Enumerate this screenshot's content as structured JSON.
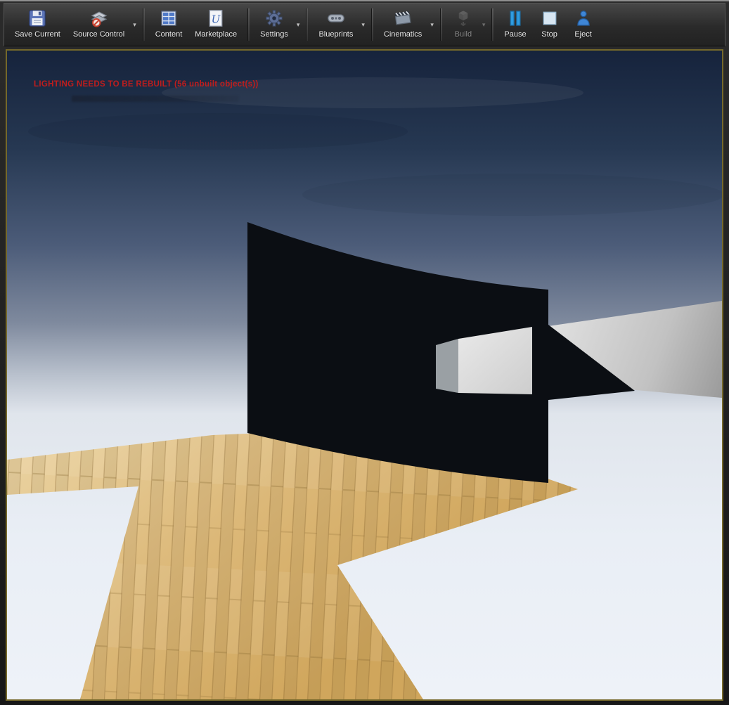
{
  "toolbar": {
    "groups": [
      [
        {
          "label": "Save Current",
          "icon": "save-icon",
          "dropdown": false,
          "enabled": true
        },
        {
          "label": "Source Control",
          "icon": "source-control-icon",
          "dropdown": true,
          "enabled": true
        }
      ],
      [
        {
          "label": "Content",
          "icon": "content-icon",
          "dropdown": false,
          "enabled": true
        },
        {
          "label": "Marketplace",
          "icon": "marketplace-icon",
          "dropdown": false,
          "enabled": true
        }
      ],
      [
        {
          "label": "Settings",
          "icon": "settings-icon",
          "dropdown": true,
          "enabled": true
        }
      ],
      [
        {
          "label": "Blueprints",
          "icon": "blueprints-icon",
          "dropdown": true,
          "enabled": true
        }
      ],
      [
        {
          "label": "Cinematics",
          "icon": "cinematics-icon",
          "dropdown": true,
          "enabled": true
        }
      ],
      [
        {
          "label": "Build",
          "icon": "build-icon",
          "dropdown": true,
          "enabled": false
        }
      ],
      [
        {
          "label": "Pause",
          "icon": "pause-icon",
          "dropdown": false,
          "enabled": true
        },
        {
          "label": "Stop",
          "icon": "stop-icon",
          "dropdown": false,
          "enabled": true
        },
        {
          "label": "Eject",
          "icon": "eject-icon",
          "dropdown": false,
          "enabled": true
        }
      ]
    ]
  },
  "viewport": {
    "warning": "LIGHTING NEEDS TO BE REBUILT (56 unbuilt object(s))",
    "warning_color": "#bf1d1d",
    "unbuilt_objects": 56
  },
  "colors": {
    "pie_border": "#75682a",
    "toolbar_bg": "#2e2e2e",
    "wood_floor": "#d8b272",
    "sky_top": "#16233c",
    "sky_bottom": "#eef2f8"
  }
}
